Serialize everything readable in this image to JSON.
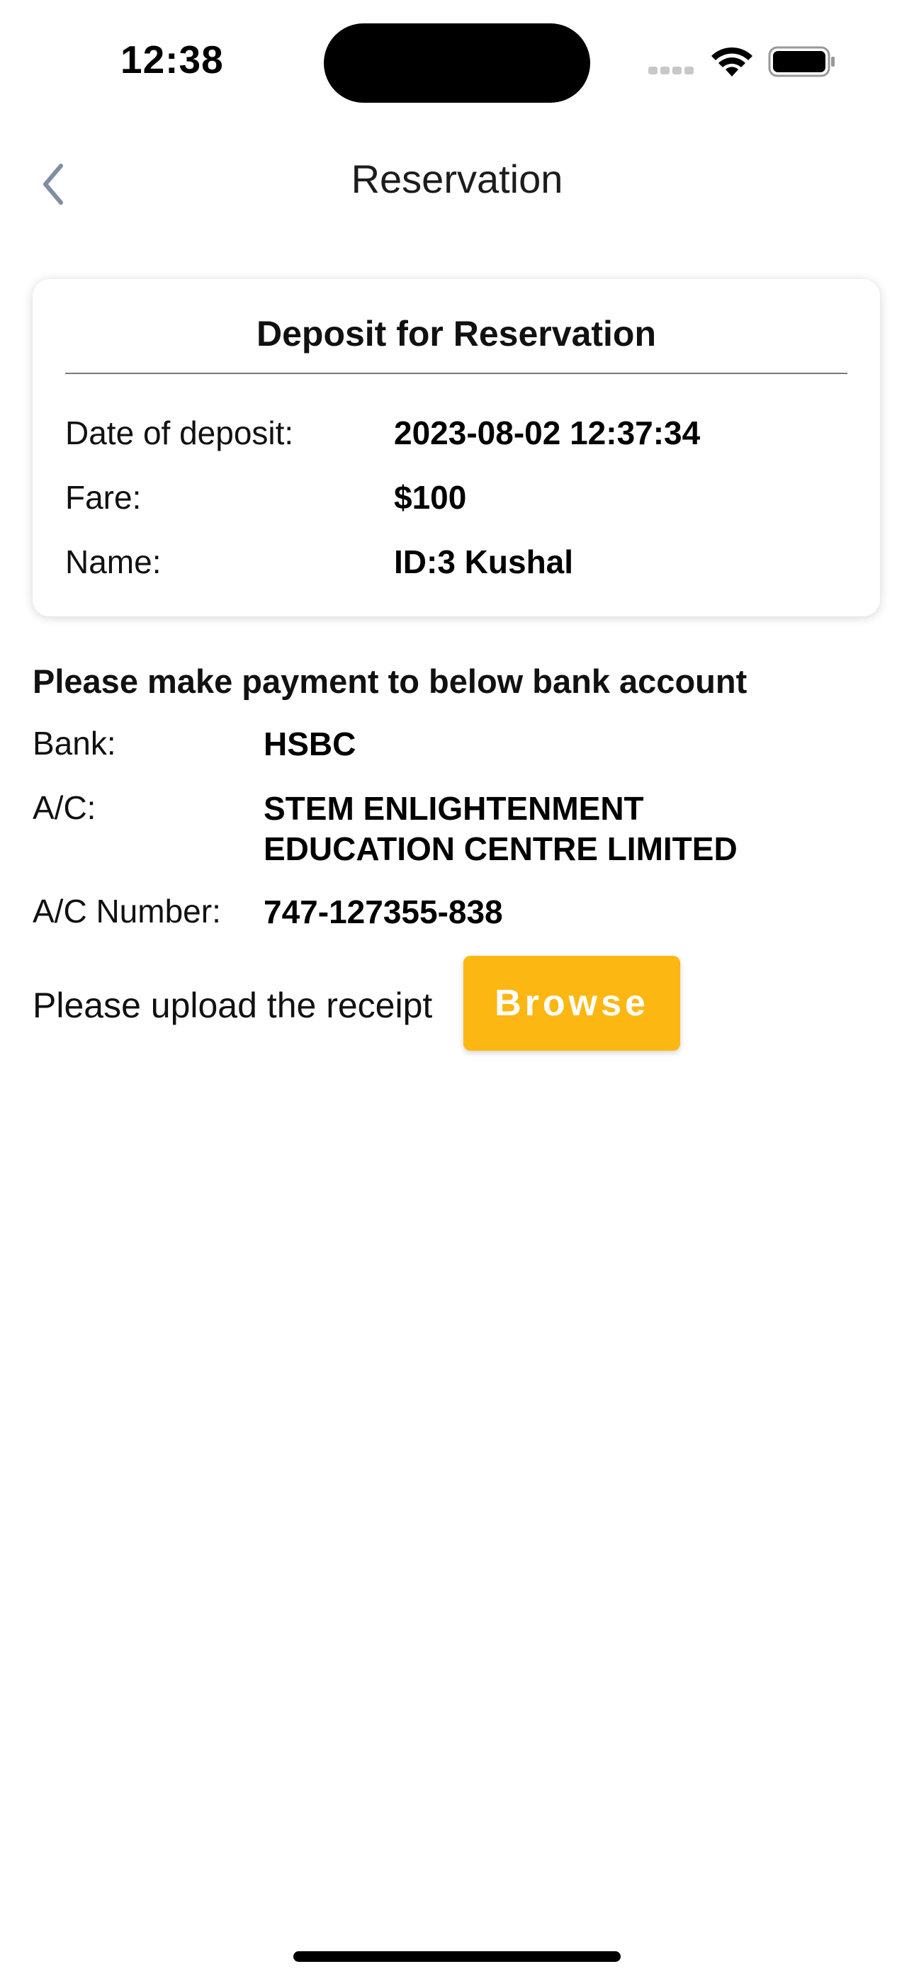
{
  "status_bar": {
    "time": "12:38"
  },
  "nav": {
    "title": "Reservation",
    "back_icon": "chevron-left-icon"
  },
  "deposit_card": {
    "title": "Deposit for Reservation",
    "rows": [
      {
        "label": "Date of deposit:",
        "value": "2023-08-02 12:37:34"
      },
      {
        "label": "Fare:",
        "value": "$100"
      },
      {
        "label": "Name:",
        "value": "ID:3 Kushal"
      }
    ]
  },
  "payment": {
    "heading": "Please make payment to below bank account",
    "bank": {
      "label": "Bank:",
      "value": "HSBC"
    },
    "account": {
      "label": "A/C:",
      "value_line1": "STEM ENLIGHTENMENT",
      "value_line2": "EDUCATION CENTRE LIMITED"
    },
    "account_number": {
      "label": "A/C Number:",
      "value": "747-127355-838"
    }
  },
  "upload": {
    "label": "Please upload the receipt",
    "button_label": "Browse"
  },
  "colors": {
    "accent": "#fdb713",
    "back_icon": "#7f8ea3"
  }
}
